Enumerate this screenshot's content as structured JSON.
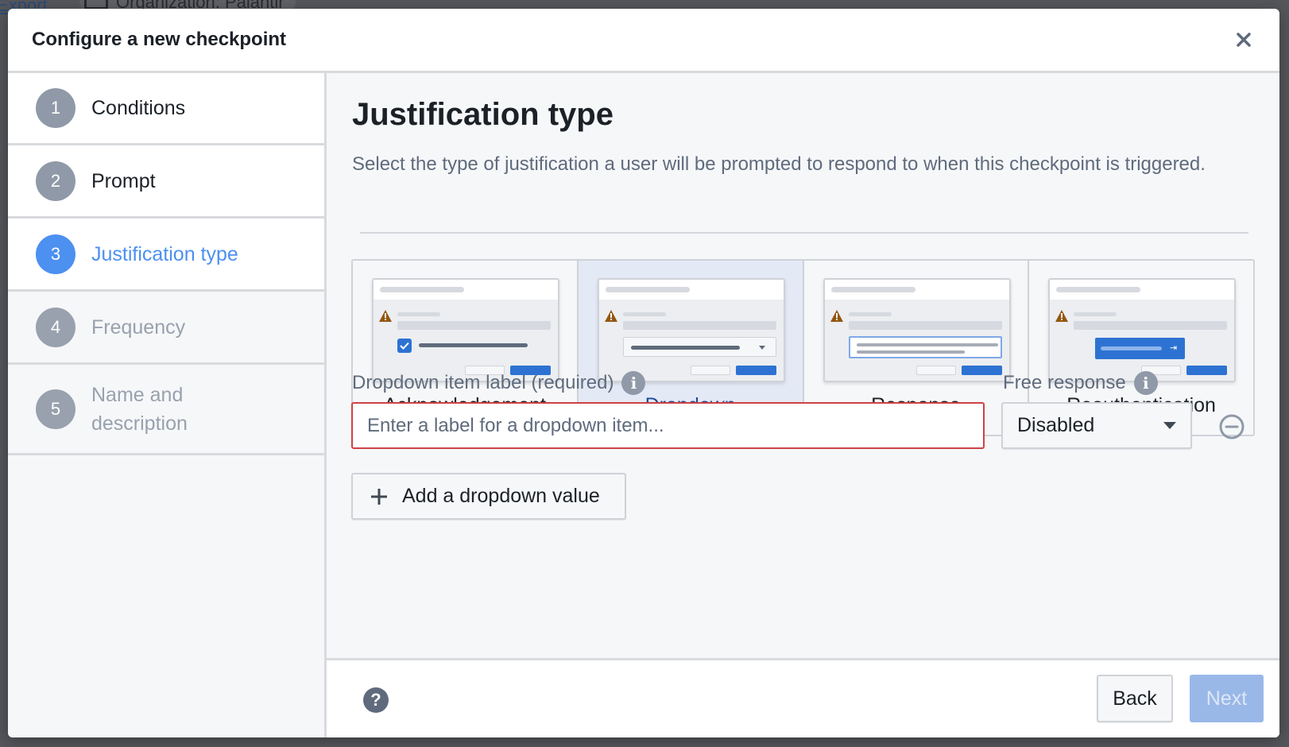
{
  "backdrop": {
    "export_link": "Export",
    "organization": "Organization: Palantir"
  },
  "modal": {
    "title": "Configure a new checkpoint",
    "close_icon": "close-icon"
  },
  "steps": [
    {
      "number": "1",
      "label": "Conditions",
      "state": "done"
    },
    {
      "number": "2",
      "label": "Prompt",
      "state": "done"
    },
    {
      "number": "3",
      "label": "Justification type",
      "state": "active"
    },
    {
      "number": "4",
      "label": "Frequency",
      "state": "pending"
    },
    {
      "number": "5",
      "label": "Name and description",
      "state": "pending"
    }
  ],
  "main": {
    "title": "Justification type",
    "description": "Select the type of justification a user will be prompted to respond to when this checkpoint is triggered.",
    "cards": [
      {
        "label": "Acknowledgement",
        "selected": false
      },
      {
        "label": "Dropdown",
        "selected": true
      },
      {
        "label": "Response",
        "selected": false
      },
      {
        "label": "Reauthentication",
        "selected": false
      }
    ],
    "dropdown_item_label": "Dropdown item label (required)",
    "dropdown_item_placeholder": "Enter a label for a dropdown item...",
    "dropdown_item_value": "",
    "free_response_label": "Free response",
    "free_response_value": "Disabled",
    "add_value_label": "Add a dropdown value"
  },
  "footer": {
    "back_label": "Back",
    "next_label": "Next",
    "next_disabled": true
  },
  "colors": {
    "accent": "#4c90f0",
    "primary": "#2d72d2",
    "error": "#cd4246",
    "selected_card": "#e4e9f6",
    "warning": "#935610"
  }
}
